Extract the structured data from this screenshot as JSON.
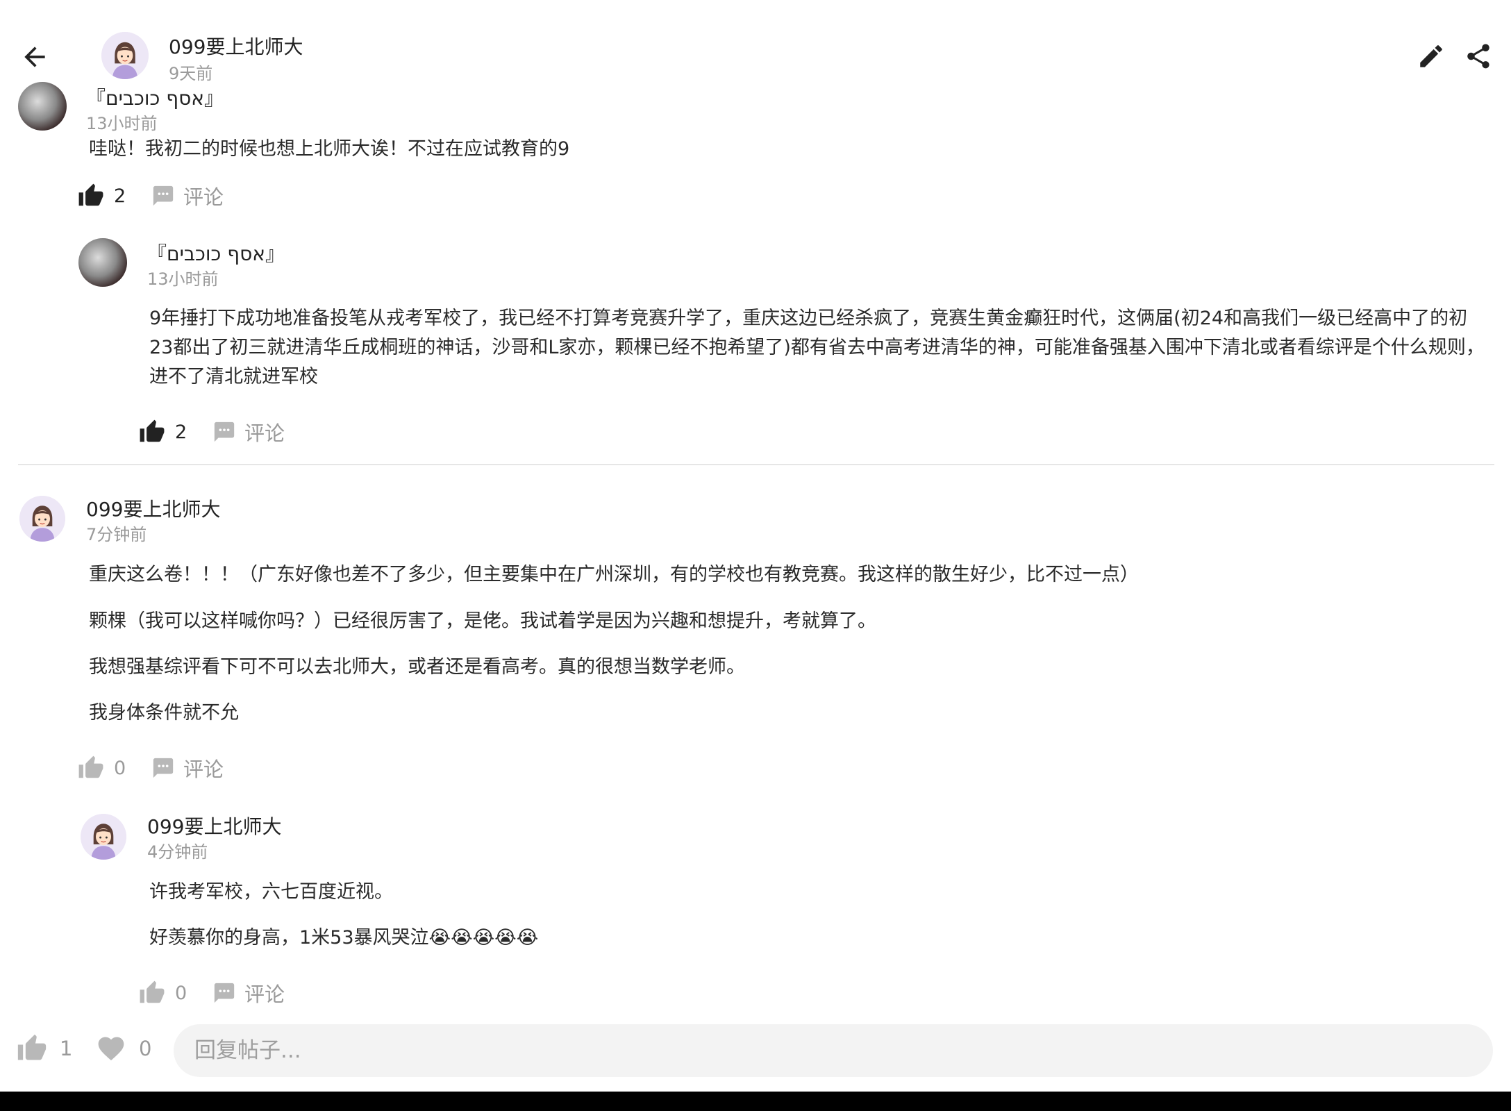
{
  "header": {
    "author": "099要上北师大",
    "time": "9天前"
  },
  "comments": [
    {
      "author": "『אסף כוכבים』",
      "time": "13小时前",
      "paragraphs": [
        "哇哒！我初二的时候也想上北师大诶！不过在应试教育的9"
      ],
      "likes": "2",
      "comment_label": "评论",
      "reply": {
        "author": "『אסף כוכבים』",
        "time": "13小时前",
        "paragraphs": [
          "9年捶打下成功地准备投笔从戎考军校了，我已经不打算考竞赛升学了，重庆这边已经杀疯了，竞赛生黄金癫狂时代，这俩届(初24和高我们一级已经高中了的初23都出了初三就进清华丘成桐班的神话，沙哥和L家亦，颗棵已经不抱希望了)都有省去中高考进清华的神，可能准备强基入围冲下清北或者看综评是个什么规则，进不了清北就进军校"
        ],
        "likes": "2",
        "comment_label": "评论"
      }
    },
    {
      "author": "099要上北师大",
      "time": "7分钟前",
      "paragraphs": [
        "重庆这么卷！！！（广东好像也差不了多少，但主要集中在广州深圳，有的学校也有教竞赛。我这样的散生好少，比不过一点）",
        "颗棵（我可以这样喊你吗？）已经很厉害了，是佬。我试着学是因为兴趣和想提升，考就算了。",
        "我想强基综评看下可不可以去北师大，或者还是看高考。真的很想当数学老师。",
        "我身体条件就不允"
      ],
      "likes": "0",
      "comment_label": "评论",
      "reply": {
        "author": "099要上北师大",
        "time": "4分钟前",
        "paragraphs": [
          "许我考军校，六七百度近视。",
          "好羡慕你的身高，1米53暴风哭泣😭😭😭😭😭"
        ],
        "likes": "0",
        "comment_label": "评论"
      }
    }
  ],
  "bottom": {
    "likes": "1",
    "favorites": "0",
    "reply_placeholder": "回复帖子..."
  },
  "icons": {
    "back": "arrow-left-icon",
    "edit": "pencil-icon",
    "share": "share-icon",
    "like": "thumb-up-icon",
    "comment": "chat-bubble-icon",
    "favorite": "heart-icon"
  },
  "colors": {
    "text": "#222222",
    "muted": "#9a9a9a",
    "icon_active": "#222222",
    "icon_inactive": "#b8b8b8",
    "input_bg": "#f3f3f3"
  }
}
